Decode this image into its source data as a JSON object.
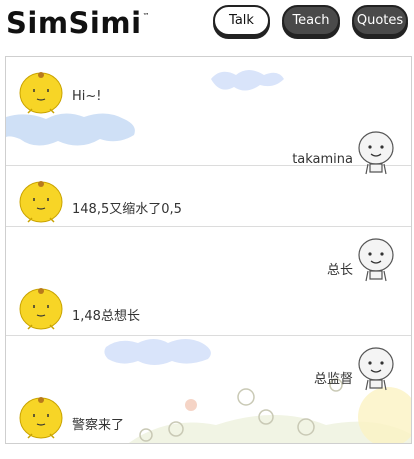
{
  "header": {
    "logo_text": "SimSimi",
    "logo_tm": "™",
    "nav": {
      "talk_label": "Talk",
      "teach_label": "Teach",
      "quotes_label": "Quotes"
    }
  },
  "conversation": [
    {
      "user": "",
      "bot": "Hi~!"
    },
    {
      "user": "takamina",
      "bot": "148,5又缩水了0,5"
    },
    {
      "user": "总长",
      "bot": "1,48总想长"
    },
    {
      "user": "总监督",
      "bot": "警察来了"
    }
  ],
  "colors": {
    "bot_yellow": "#f7d526",
    "cloud_blue": "#cfdff8",
    "border": "#cfcfcf"
  },
  "icons": {
    "bot_avatar": "simsimi-yellow-face-icon",
    "user_avatar": "white-doll-face-icon"
  }
}
